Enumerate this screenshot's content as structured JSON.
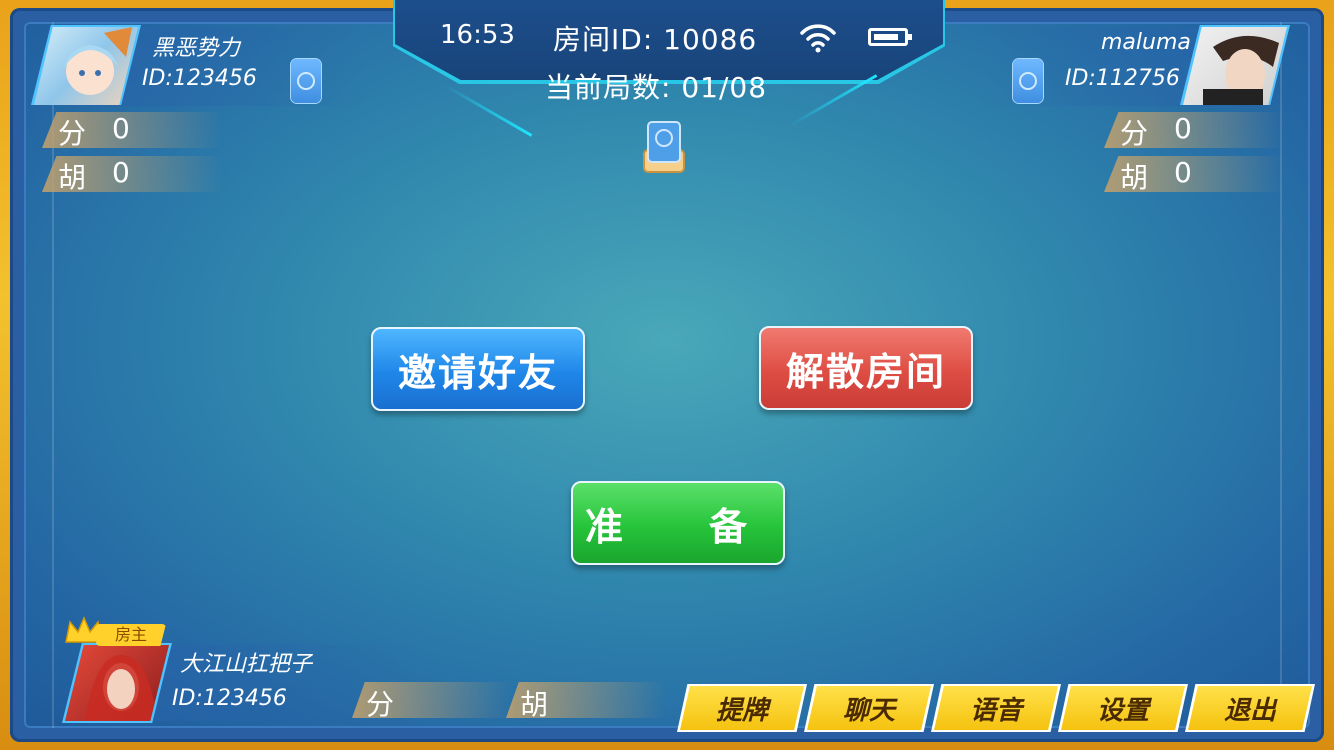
{
  "status": {
    "time": "16:53",
    "room_label": "房间ID: 10086",
    "round_label": "当前局数: 01/08",
    "wifi_icon": "wifi-icon",
    "battery_icon": "battery-icon"
  },
  "players": {
    "top_left": {
      "name": "黑恶势力",
      "id": "ID:123456",
      "score_label": "分",
      "score": "0",
      "hu_label": "胡",
      "hu": "0"
    },
    "top_right": {
      "name": "maluma",
      "id": "ID:112756",
      "score_label": "分",
      "score": "0",
      "hu_label": "胡",
      "hu": "0"
    },
    "self": {
      "name": "大江山扛把子",
      "id": "ID:123456",
      "badge": "房主",
      "score_label": "分",
      "hu_label": "胡"
    }
  },
  "actions": {
    "invite": "邀请好友",
    "dissolve": "解散房间",
    "ready": "准　备"
  },
  "menu": [
    "提牌",
    "聊天",
    "语音",
    "设置",
    "退出"
  ],
  "colors": {
    "frame": "#f3c12e",
    "table": "#2f86ad",
    "invite": "#1f87e8",
    "dissolve": "#de4d44",
    "ready": "#26c43a",
    "menu": "#f5c20f"
  }
}
